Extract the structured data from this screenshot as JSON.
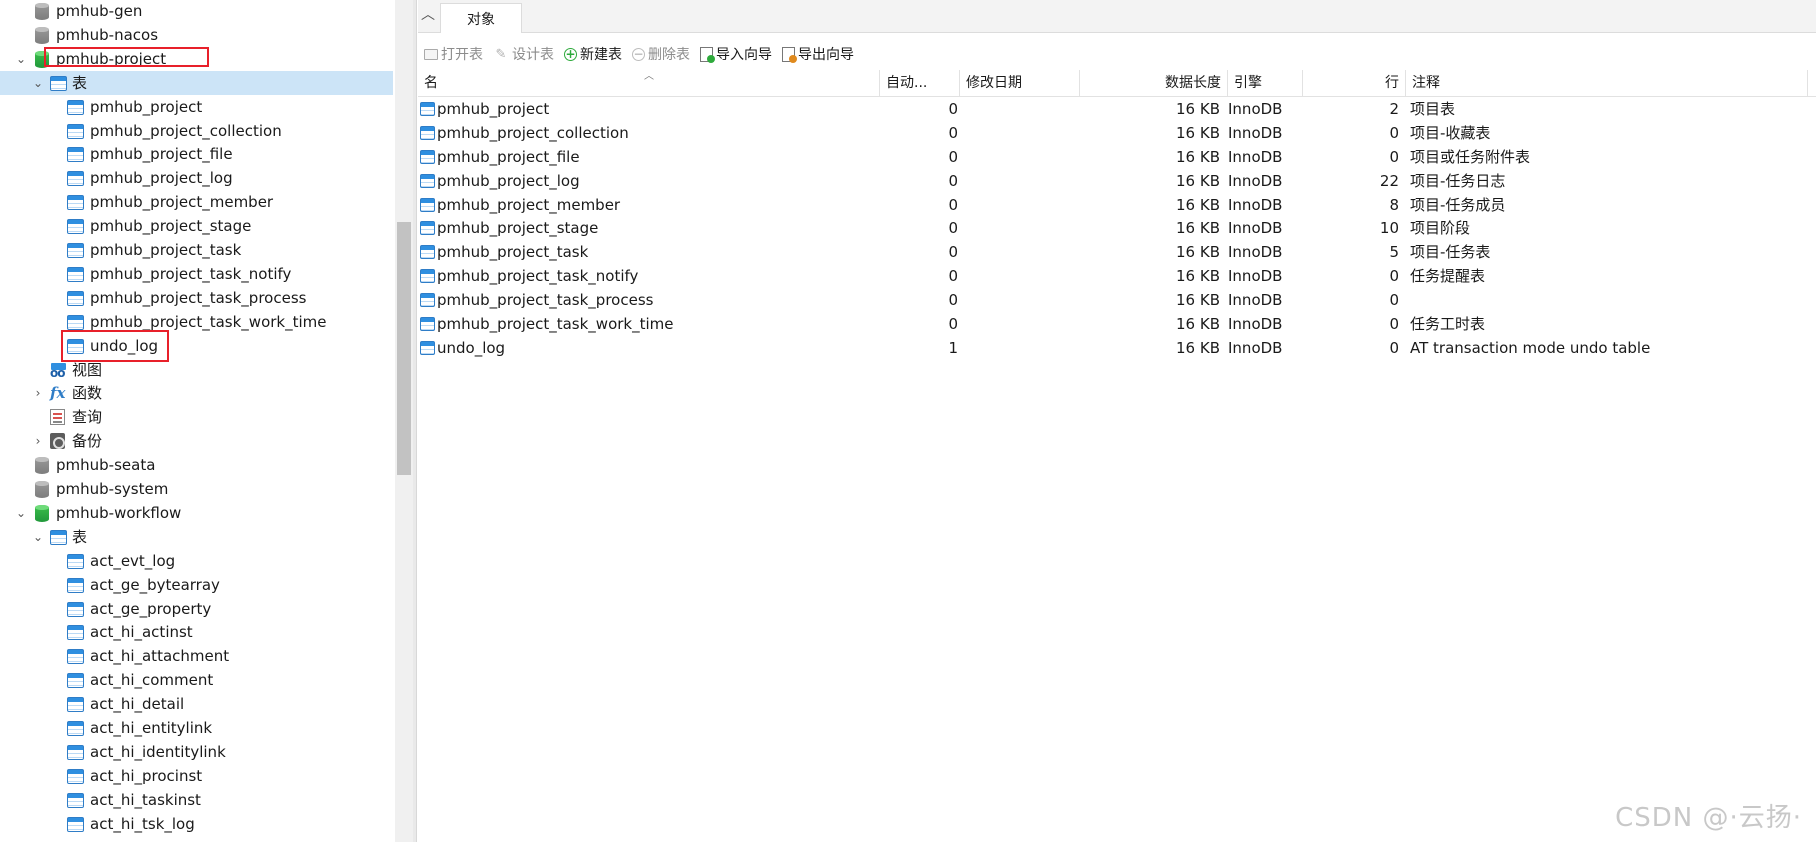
{
  "tree": {
    "items": [
      {
        "label": "pmhub-gen",
        "level": 0,
        "type": "db",
        "chevron": ""
      },
      {
        "label": "pmhub-nacos",
        "level": 0,
        "type": "db",
        "chevron": ""
      },
      {
        "label": "pmhub-project",
        "level": 0,
        "type": "db-open",
        "chevron": "⌄"
      },
      {
        "label": "表",
        "level": 1,
        "type": "tables",
        "chevron": "⌄",
        "selected": true
      },
      {
        "label": "pmhub_project",
        "level": 2,
        "type": "table"
      },
      {
        "label": "pmhub_project_collection",
        "level": 2,
        "type": "table"
      },
      {
        "label": "pmhub_project_file",
        "level": 2,
        "type": "table"
      },
      {
        "label": "pmhub_project_log",
        "level": 2,
        "type": "table"
      },
      {
        "label": "pmhub_project_member",
        "level": 2,
        "type": "table"
      },
      {
        "label": "pmhub_project_stage",
        "level": 2,
        "type": "table"
      },
      {
        "label": "pmhub_project_task",
        "level": 2,
        "type": "table"
      },
      {
        "label": "pmhub_project_task_notify",
        "level": 2,
        "type": "table"
      },
      {
        "label": "pmhub_project_task_process",
        "level": 2,
        "type": "table"
      },
      {
        "label": "pmhub_project_task_work_time",
        "level": 2,
        "type": "table"
      },
      {
        "label": "undo_log",
        "level": 2,
        "type": "table"
      },
      {
        "label": "视图",
        "level": 1,
        "type": "view",
        "chevron": ""
      },
      {
        "label": "函数",
        "level": 1,
        "type": "func",
        "chevron": "›"
      },
      {
        "label": "查询",
        "level": 1,
        "type": "query",
        "chevron": ""
      },
      {
        "label": "备份",
        "level": 1,
        "type": "backup",
        "chevron": "›"
      },
      {
        "label": "pmhub-seata",
        "level": 0,
        "type": "db",
        "chevron": ""
      },
      {
        "label": "pmhub-system",
        "level": 0,
        "type": "db",
        "chevron": ""
      },
      {
        "label": "pmhub-workflow",
        "level": 0,
        "type": "db-open",
        "chevron": "⌄"
      },
      {
        "label": "表",
        "level": 1,
        "type": "tables",
        "chevron": "⌄"
      },
      {
        "label": "act_evt_log",
        "level": 2,
        "type": "table"
      },
      {
        "label": "act_ge_bytearray",
        "level": 2,
        "type": "table"
      },
      {
        "label": "act_ge_property",
        "level": 2,
        "type": "table"
      },
      {
        "label": "act_hi_actinst",
        "level": 2,
        "type": "table"
      },
      {
        "label": "act_hi_attachment",
        "level": 2,
        "type": "table"
      },
      {
        "label": "act_hi_comment",
        "level": 2,
        "type": "table"
      },
      {
        "label": "act_hi_detail",
        "level": 2,
        "type": "table"
      },
      {
        "label": "act_hi_entitylink",
        "level": 2,
        "type": "table"
      },
      {
        "label": "act_hi_identitylink",
        "level": 2,
        "type": "table"
      },
      {
        "label": "act_hi_procinst",
        "level": 2,
        "type": "table"
      },
      {
        "label": "act_hi_taskinst",
        "level": 2,
        "type": "table"
      },
      {
        "label": "act_hi_tsk_log",
        "level": 2,
        "type": "table"
      }
    ]
  },
  "tabbar": {
    "collapse_icon": "chevron-up-icon",
    "tab_label": "对象"
  },
  "toolbar": {
    "open_table": "打开表",
    "design_table": "设计表",
    "new_table": "新建表",
    "delete_table": "删除表",
    "import_wizard": "导入向导",
    "export_wizard": "导出向导"
  },
  "grid": {
    "columns": {
      "name": "名",
      "auto_increment": "自动...",
      "modified_date": "修改日期",
      "data_length": "数据长度",
      "engine": "引擎",
      "rows": "行",
      "comment": "注释"
    },
    "rows": [
      {
        "name": "pmhub_project",
        "auto": "0",
        "date": "",
        "size": "16 KB",
        "engine": "InnoDB",
        "rows": "2",
        "comment": "项目表"
      },
      {
        "name": "pmhub_project_collection",
        "auto": "0",
        "date": "",
        "size": "16 KB",
        "engine": "InnoDB",
        "rows": "0",
        "comment": "项目-收藏表"
      },
      {
        "name": "pmhub_project_file",
        "auto": "0",
        "date": "",
        "size": "16 KB",
        "engine": "InnoDB",
        "rows": "0",
        "comment": "项目或任务附件表"
      },
      {
        "name": "pmhub_project_log",
        "auto": "0",
        "date": "",
        "size": "16 KB",
        "engine": "InnoDB",
        "rows": "22",
        "comment": "项目-任务日志"
      },
      {
        "name": "pmhub_project_member",
        "auto": "0",
        "date": "",
        "size": "16 KB",
        "engine": "InnoDB",
        "rows": "8",
        "comment": "项目-任务成员"
      },
      {
        "name": "pmhub_project_stage",
        "auto": "0",
        "date": "",
        "size": "16 KB",
        "engine": "InnoDB",
        "rows": "10",
        "comment": "项目阶段"
      },
      {
        "name": "pmhub_project_task",
        "auto": "0",
        "date": "",
        "size": "16 KB",
        "engine": "InnoDB",
        "rows": "5",
        "comment": "项目-任务表"
      },
      {
        "name": "pmhub_project_task_notify",
        "auto": "0",
        "date": "",
        "size": "16 KB",
        "engine": "InnoDB",
        "rows": "0",
        "comment": "任务提醒表"
      },
      {
        "name": "pmhub_project_task_process",
        "auto": "0",
        "date": "",
        "size": "16 KB",
        "engine": "InnoDB",
        "rows": "0",
        "comment": ""
      },
      {
        "name": "pmhub_project_task_work_time",
        "auto": "0",
        "date": "",
        "size": "16 KB",
        "engine": "InnoDB",
        "rows": "0",
        "comment": "任务工时表"
      },
      {
        "name": "undo_log",
        "auto": "1",
        "date": "",
        "size": "16 KB",
        "engine": "InnoDB",
        "rows": "0",
        "comment": "AT transaction mode undo table"
      }
    ]
  },
  "watermark": "CSDN @·云扬·",
  "colors": {
    "selection": "#cce4f7",
    "highlight_box": "#e8202a",
    "db_open": "#21983b",
    "table_icon": "#2f8fe0"
  }
}
